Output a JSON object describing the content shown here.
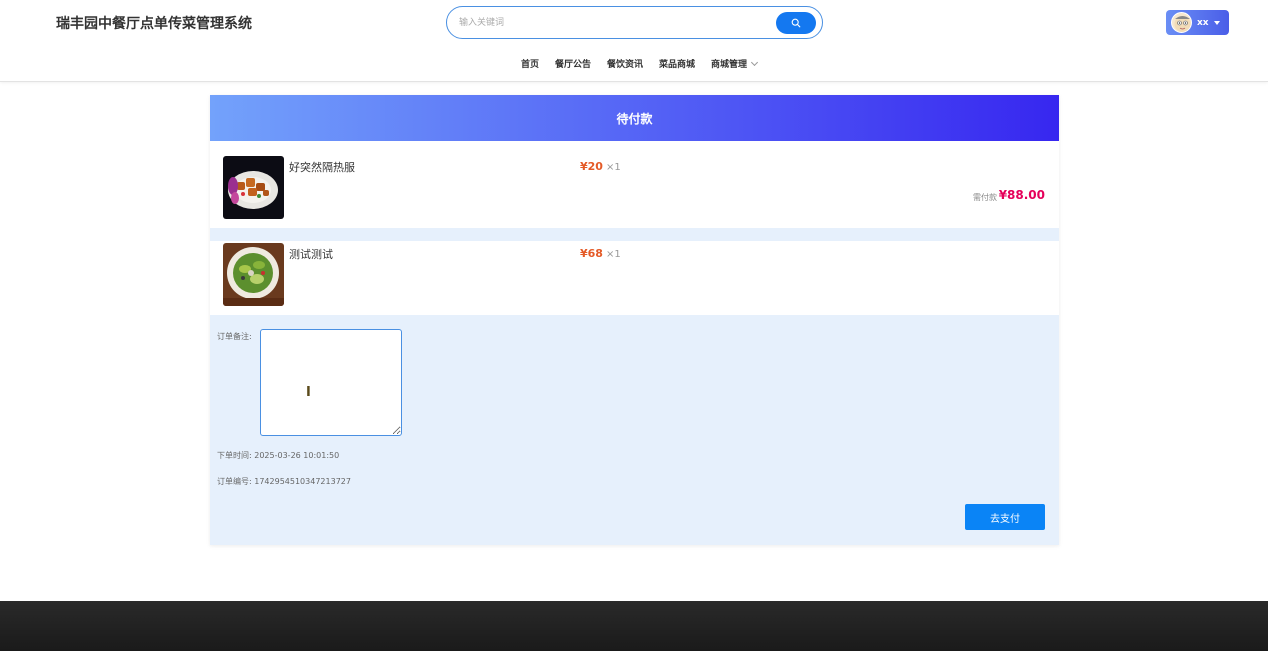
{
  "header": {
    "site_title": "瑞丰园中餐厅点单传菜管理系统",
    "search_placeholder": "输入关键词",
    "user_name": "xx"
  },
  "nav": {
    "items": [
      "首页",
      "餐厅公告",
      "餐饮资讯",
      "菜品商城"
    ],
    "dropdown_label": "商城管理"
  },
  "order": {
    "status_title": "待付款",
    "items": [
      {
        "name": "好突然隔热服",
        "price": "¥20",
        "qty": "×1"
      },
      {
        "name": "测试测试",
        "price": "¥68",
        "qty": "×1"
      }
    ],
    "pay_label": "需付款",
    "pay_amount": "¥88.00",
    "remark_label": "订单备注:",
    "remark_value": "",
    "order_time_label": "下单时间:",
    "order_time": "2025-03-26 10:01:50",
    "order_no_label": "订单编号:",
    "order_no": "1742954510347213727",
    "pay_button": "去支付"
  },
  "colors": {
    "accent": "#0a84f6",
    "price": "#e45a27",
    "total": "#e5005a",
    "header_grad_start": "#73a2fb",
    "header_grad_end": "#3727f0"
  }
}
